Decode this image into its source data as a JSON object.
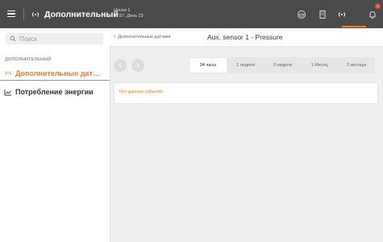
{
  "header": {
    "title": "Дополнительный",
    "house_name": "House 1",
    "house_time": "11:57, День 23",
    "notification_count": "8",
    "accent": "#f07c1b"
  },
  "sidebar": {
    "search_placeholder": "Поиск",
    "section_label": "ДОПОЛНИТЕЛЬНЫЙ",
    "items": [
      {
        "label": "Дополнительные датчики",
        "icon": "wifi-signal-icon",
        "active": true
      },
      {
        "label": "Потребление энергии",
        "icon": "energy-chart-icon",
        "active": false
      }
    ]
  },
  "main": {
    "breadcrumb": "Дополнительные датчики",
    "title": "Aux. sensor 1 - Pressure",
    "tabs": [
      "24 часы",
      "1 неделя",
      "3 недели",
      "1 Месяц",
      "2 месяцы"
    ],
    "selected_tab": "24 часы",
    "empty_message": "Нет данных событий"
  }
}
